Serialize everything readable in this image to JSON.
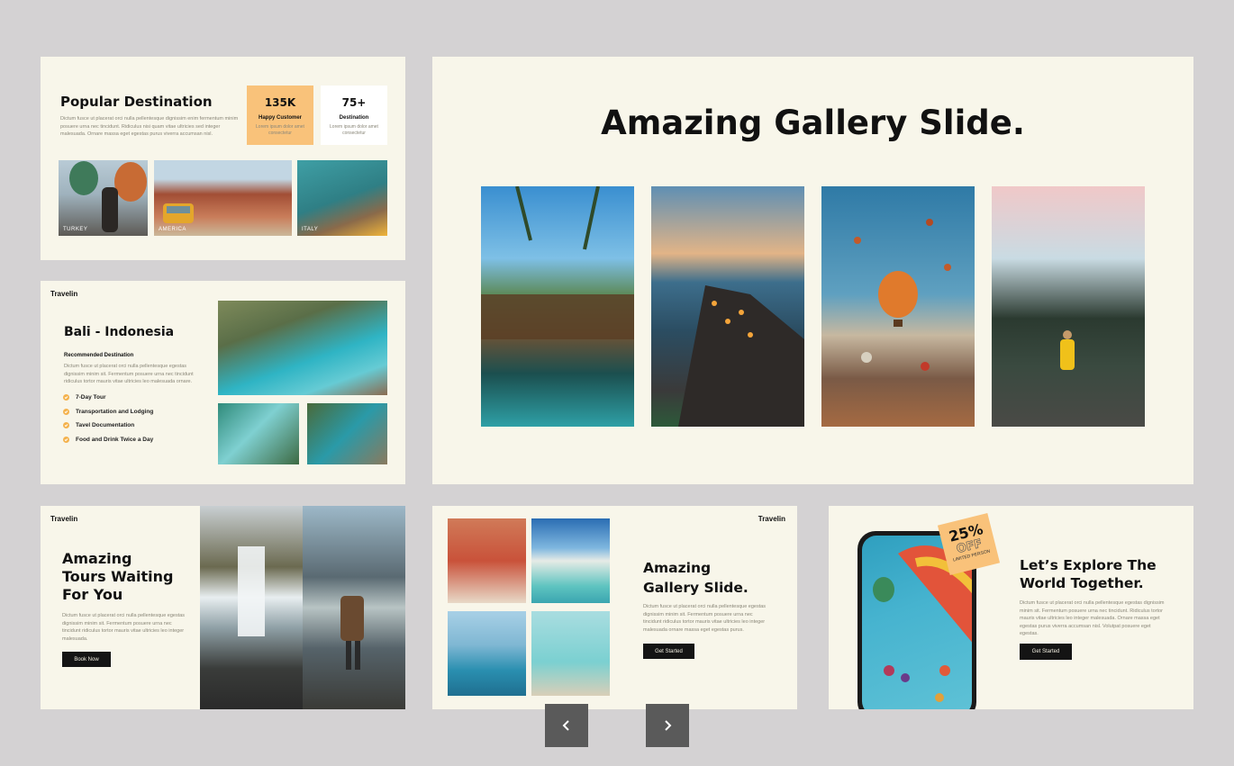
{
  "slide1": {
    "title": "Popular Destination",
    "body": "Dictum fusce ut placerat orci nulla pellentesque dignissim enim fermentum minim posuere urna nec tincidunt. Ridiculus nisi quam vitae ultricies sed integer malesuada. Ornare massa eget egestas purus viverra accumsan nisl.",
    "stats": [
      {
        "value": "135K",
        "label": "Happy Customer",
        "sub": "Lorem ipsum dolor amet consectetur"
      },
      {
        "value": "75+",
        "label": "Destination",
        "sub": "Lorem ipsum dolor amet consectetur"
      }
    ],
    "photos": [
      "TURKEY",
      "AMERICA",
      "ITALY"
    ]
  },
  "slide2": {
    "brand": "Travelin",
    "title": "Bali - Indonesia",
    "subtitle": "Recommended Destination",
    "body": "Dictum fusce ut placerat orci nulla pellentesque egestas dignissim minim sit. Fermentum posuere urna nec tincidunt ridiculus tortor mauris vitae ultricies leo malesuada ornare.",
    "items": [
      "7-Day Tour",
      "Transportation and Lodging",
      "Tavel Documentation",
      "Food and Drink Twice a Day"
    ]
  },
  "main_slide": {
    "title": "Amazing Gallery Slide."
  },
  "slide3": {
    "brand": "Travelin",
    "title_lines": [
      "Amazing",
      "Tours Waiting",
      "For You"
    ],
    "body": "Dictum fusce ut placerat orci nulla pellentesque egestas dignissim minim sit. Fermentum posuere urna nec tincidunt ridiculus tortor mauris vitae ultricies leo integer malesuada.",
    "button": "Book Now"
  },
  "slide4": {
    "brand": "Travelin",
    "title_lines": [
      "Amazing",
      "Gallery Slide."
    ],
    "body": "Dictum fusce ut placerat orci nulla pellentesque egestas dignissim minim sit. Fermentum posuere urna nec tincidunt ridiculus tortor mauris vitae ultricies leo integer malesuada ornare massa eget egestas purus.",
    "button": "Get Started"
  },
  "slide5": {
    "title_lines": [
      "Let’s Explore The",
      "World Together."
    ],
    "body": "Dictum fusce ut placerat orci nulla pellentesque egestas dignissim minim sit. Fermentum posuere urna nec tincidunt. Ridiculus tortor mauris vitae ultricies leo integer malesuada. Ornare massa eget egestas purus viverra accumsan nisl. Volutpat posuere eget egestas.",
    "button": "Get Started",
    "badge": {
      "value": "25%",
      "off": "OFF",
      "sub": "LIMITED PERSON"
    }
  },
  "nav": {
    "prev_icon": "chevron-left-icon",
    "next_icon": "chevron-right-icon"
  },
  "colors": {
    "background": "#d4d2d3",
    "slide": "#f8f6ea",
    "accent": "#f9c27a",
    "dark": "#141414",
    "nav": "#5a5a5a"
  }
}
